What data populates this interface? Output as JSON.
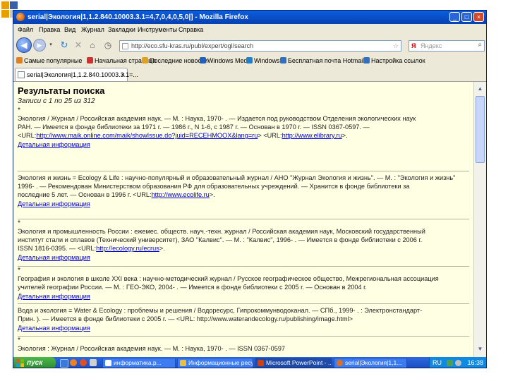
{
  "window": {
    "title": "serial|Экология|1,1.2.840.10003.3.1=4,7,0,4,0,5,0|] - Mozilla Firefox",
    "buttons": {
      "minimize": "_",
      "maximize": "□",
      "close": "×"
    }
  },
  "menubar": [
    "Файл",
    "Правка",
    "Вид",
    "Журнал",
    "Закладки",
    "Инструменты",
    "Справка"
  ],
  "navbar": {
    "url": "http://eco.sfu-kras.ru/publ/expert/ogl/search",
    "search_placeholder": "Яндекс",
    "search_engine_letter": "Я"
  },
  "bookmarks": [
    {
      "label": "Самые популярные",
      "color": "#e08020"
    },
    {
      "label": "Начальная страница",
      "color": "#d03030"
    },
    {
      "label": "Последние новости",
      "color": "#e0a020"
    },
    {
      "label": "Windows Media",
      "color": "#2060c0"
    },
    {
      "label": "Windows",
      "color": "#2080d0"
    },
    {
      "label": "Бесплатная почта Hotmail",
      "color": "#3070c0"
    },
    {
      "label": "Настройка ссылок",
      "color": "#3070c0"
    }
  ],
  "tab": {
    "label": "serial|Экология|1,1.2.840.10003.3.1=...",
    "close": "×"
  },
  "page": {
    "heading": "Результаты поиска",
    "subheading": "Записи с 1 по 25 из 312",
    "records": [
      {
        "bullet": "*",
        "lines": [
          "Экология / Журнал / Российская академия наук. — М. : Наука, 1970- . — Издается под руководством Отделения экологических наук",
          "РАН. — Имеется в фонде библиотеки за 1971 г. — 1986 г., N 1-6, с 1987 г. — Основан в 1970 г. — ISSN 0367-0597. —"
        ],
        "url_prefix": "<URL:",
        "url1": "http://www.maik.online.com/maik/showIssue.do?juid=RECEHMOOX&lang=ru",
        "url_mid": "> <URL:",
        "url2": "http://www.elibrary.ru",
        "url_suffix": ">.",
        "more": "Детальная информация"
      },
      {
        "bullet": "",
        "lines": [
          "Экология и жизнь = Ecology & Life : научно-популярный и образовательный журнал / АНО \"Журнал Экология и жизнь\". — М. : \"Экология и жизнь\"",
          "1996- . — Рекомендован Министерством образования РФ для образовательных учреждений. — Хранится в фонде библиотеки за",
          "последние 5 лет. — Основан в 1996 г."
        ],
        "url_prefix": "<URL:",
        "url1": "http://www.ecolife.ru",
        "url_mid": "",
        "url2": "",
        "url_suffix": ">.",
        "more": "Детальная информация"
      },
      {
        "bullet": "*",
        "lines": [
          "Экология и промышленность России : ежемес. обществ. науч.-техн. журнал / Российская академия наук, Московский государственный",
          "институт стали и сплавов (Технический университет), ЗАО \"Калвис\". — М. : \"Калвис\", 1996- . — Имеется в фонде библиотеки с 2006 г.",
          "ISSN 1816-0395. —"
        ],
        "url_prefix": "<URL:",
        "url1": "http://ecology.ru/ecrus",
        "url_mid": "",
        "url2": "",
        "url_suffix": ">.",
        "more": "Детальная информация"
      },
      {
        "bullet": "*",
        "lines": [
          "География и экология в школе XXI века : научно-методический журнал / Русское географическое общество, Межрегиональная ассоциация",
          "учителей географии России. — М. : ГЕО-ЭКО, 2004- . — Имеется в фонде библиотеки с 2005 г. — Основан в 2004 г."
        ],
        "url_prefix": "",
        "url1": "",
        "url_mid": "",
        "url2": "",
        "url_suffix": "",
        "more": "Детальная информация"
      },
      {
        "bullet": "",
        "lines": [
          "Вода и экология = Water & Ecology : проблемы и решения / Водоресурс, Гипрокоммунводоканал. — СПб., 1999- . : Электронстандарт-",
          "Прин. ). — Имеется в фонде библиотеки с 2005 г. — <URL: http://www.waterandecology.ru/publishing/image.html>"
        ],
        "url_prefix": "",
        "url1": "",
        "url_mid": "",
        "url2": "",
        "url_suffix": "",
        "more": "Детальная информация"
      },
      {
        "bullet": "*",
        "lines": [
          "Экология : Журнал / Российская академия наук. — М. : Наука, 1970- . — ISSN 0367-0597"
        ],
        "url_prefix": "",
        "url1": "",
        "url_mid": "",
        "url2": "",
        "url_suffix": "",
        "more": ""
      }
    ]
  },
  "taskbar": {
    "start": "пуск",
    "items": [
      {
        "label": "информатика.р...",
        "color": "#ffffff",
        "active": false
      },
      {
        "label": "Информационные ресу...",
        "color": "#e8c040",
        "active": false
      },
      {
        "label": "Microsoft PowerPoint - ...",
        "color": "#d04010",
        "active": true
      },
      {
        "label": "serial|Экология|1,1...",
        "color": "#e07020",
        "active": false
      }
    ],
    "lang": "RU",
    "clock": "16:38"
  },
  "colors": {
    "slide_orange": "#e8a000",
    "slide_blue": "#3a5fa8",
    "page_bg": "#ffffe4",
    "link": "#0000cc"
  }
}
